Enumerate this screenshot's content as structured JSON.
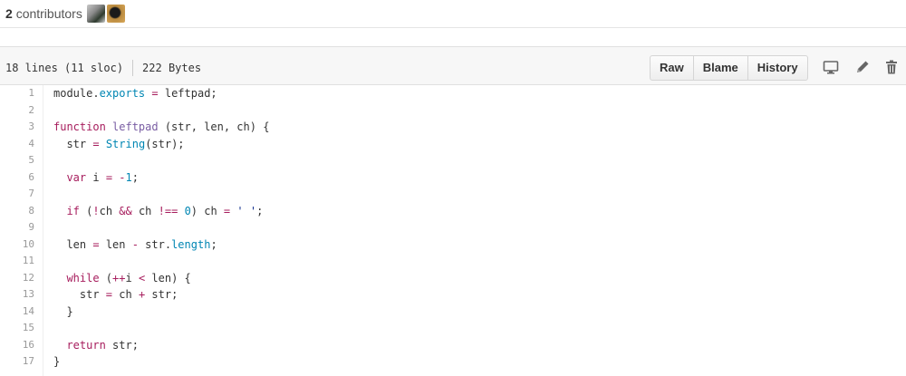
{
  "contributors": {
    "count": "2",
    "label": "contributors"
  },
  "file_info": {
    "lines": "18 lines (11 sloc)",
    "size": "222 Bytes"
  },
  "toolbar": {
    "raw_label": "Raw",
    "blame_label": "Blame",
    "history_label": "History"
  },
  "icons": [
    "desktop-icon",
    "pencil-icon",
    "trash-icon"
  ],
  "code_lines": [
    {
      "n": "1",
      "tokens": [
        [
          "module.",
          "p"
        ],
        [
          "exports",
          "bi"
        ],
        [
          " ",
          "p"
        ],
        [
          "=",
          "kw"
        ],
        [
          " leftpad;",
          "p"
        ]
      ]
    },
    {
      "n": "2",
      "tokens": []
    },
    {
      "n": "3",
      "tokens": [
        [
          "function",
          "kw"
        ],
        [
          " ",
          "p"
        ],
        [
          "leftpad",
          "fn"
        ],
        [
          " (str, len, ch) {",
          "p"
        ]
      ]
    },
    {
      "n": "4",
      "tokens": [
        [
          "  str ",
          "p"
        ],
        [
          "=",
          "kw"
        ],
        [
          " ",
          "p"
        ],
        [
          "String",
          "bi"
        ],
        [
          "(str);",
          "p"
        ]
      ]
    },
    {
      "n": "5",
      "tokens": []
    },
    {
      "n": "6",
      "tokens": [
        [
          "  ",
          "p"
        ],
        [
          "var",
          "kw"
        ],
        [
          " i ",
          "p"
        ],
        [
          "=",
          "kw"
        ],
        [
          " ",
          "p"
        ],
        [
          "-",
          "kw"
        ],
        [
          "1",
          "bi"
        ],
        [
          ";",
          "p"
        ]
      ]
    },
    {
      "n": "7",
      "tokens": []
    },
    {
      "n": "8",
      "tokens": [
        [
          "  ",
          "p"
        ],
        [
          "if",
          "kw"
        ],
        [
          " (",
          "p"
        ],
        [
          "!",
          "kw"
        ],
        [
          "ch ",
          "p"
        ],
        [
          "&&",
          "kw"
        ],
        [
          " ch ",
          "p"
        ],
        [
          "!==",
          "kw"
        ],
        [
          " ",
          "p"
        ],
        [
          "0",
          "bi"
        ],
        [
          ") ch ",
          "p"
        ],
        [
          "=",
          "kw"
        ],
        [
          " ",
          "p"
        ],
        [
          "' '",
          "st"
        ],
        [
          ";",
          "p"
        ]
      ]
    },
    {
      "n": "9",
      "tokens": []
    },
    {
      "n": "10",
      "tokens": [
        [
          "  len ",
          "p"
        ],
        [
          "=",
          "kw"
        ],
        [
          " len ",
          "p"
        ],
        [
          "-",
          "kw"
        ],
        [
          " str.",
          "p"
        ],
        [
          "length",
          "bi"
        ],
        [
          ";",
          "p"
        ]
      ]
    },
    {
      "n": "11",
      "tokens": []
    },
    {
      "n": "12",
      "tokens": [
        [
          "  ",
          "p"
        ],
        [
          "while",
          "kw"
        ],
        [
          " (",
          "p"
        ],
        [
          "++",
          "kw"
        ],
        [
          "i ",
          "p"
        ],
        [
          "<",
          "kw"
        ],
        [
          " len) {",
          "p"
        ]
      ]
    },
    {
      "n": "13",
      "tokens": [
        [
          "    str ",
          "p"
        ],
        [
          "=",
          "kw"
        ],
        [
          " ch ",
          "p"
        ],
        [
          "+",
          "kw"
        ],
        [
          " str;",
          "p"
        ]
      ]
    },
    {
      "n": "14",
      "tokens": [
        [
          "  }",
          "p"
        ]
      ]
    },
    {
      "n": "15",
      "tokens": []
    },
    {
      "n": "16",
      "tokens": [
        [
          "  ",
          "p"
        ],
        [
          "return",
          "kw"
        ],
        [
          " str;",
          "p"
        ]
      ]
    },
    {
      "n": "17",
      "tokens": [
        [
          "}",
          "p"
        ]
      ]
    }
  ]
}
